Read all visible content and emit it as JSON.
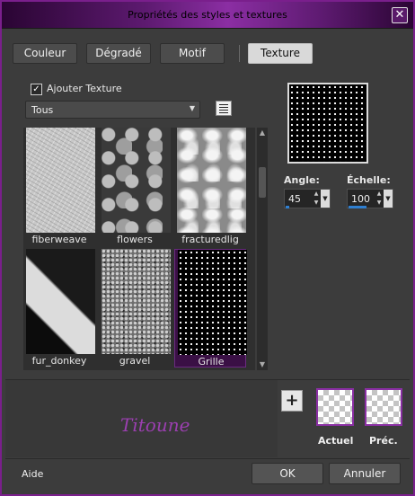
{
  "window": {
    "title": "Propriétés des styles et textures"
  },
  "tabs": [
    {
      "label": "Couleur"
    },
    {
      "label": "Dégradé"
    },
    {
      "label": "Motif"
    },
    {
      "label": "Texture"
    }
  ],
  "add_texture": {
    "label": "Ajouter Texture",
    "checked": true
  },
  "category": {
    "value": "Tous"
  },
  "textures": [
    {
      "name": "fiberweave"
    },
    {
      "name": "flowers"
    },
    {
      "name": "fracturedlig"
    },
    {
      "name": "fur_donkey"
    },
    {
      "name": "gravel"
    },
    {
      "name": "Grille",
      "selected": true
    }
  ],
  "angle": {
    "label": "Angle:",
    "value": "45",
    "fill_fraction": 0.1
  },
  "scale": {
    "label": "Échelle:",
    "value": "100",
    "fill_fraction": 0.5
  },
  "preview_actions": {
    "current_label": "Actuel",
    "previous_label": "Préc."
  },
  "signature_text": "Titoune",
  "footer": {
    "help": "Aide",
    "ok": "OK",
    "cancel": "Annuler"
  },
  "colors": {
    "accent": "#8b2ea3",
    "selection_bar": "#2f7fd0"
  }
}
